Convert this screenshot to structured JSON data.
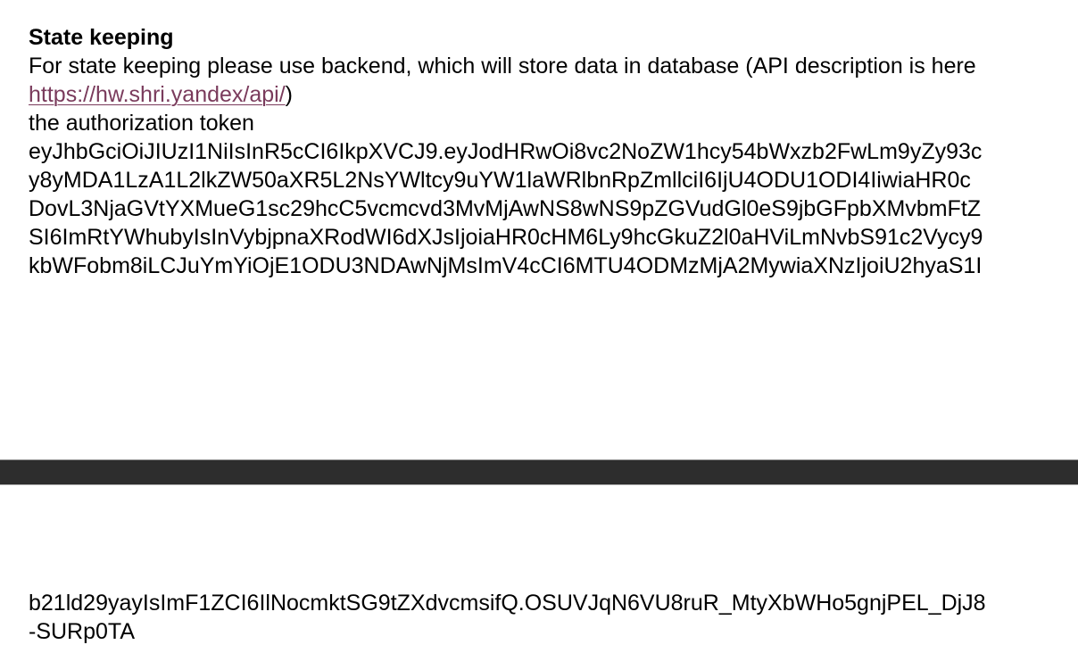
{
  "section": {
    "heading": "State keeping",
    "intro": "For state keeping please use backend, which will store data in database (API description is here",
    "api_link_text": "https://hw.shri.yandex/api/",
    "api_link_suffix": ")",
    "token_label": "the authorization token",
    "token_lines_page1": [
      "eyJhbGciOiJIUzI1NiIsInR5cCI6IkpXVCJ9.eyJodHRwOi8vc2NoZW1hcy54bWxzb2FwLm9yZy93c",
      "y8yMDA1LzA1L2lkZW50aXR5L2NsYWltcy9uYW1laWRlbnRpZmllciI6IjU4ODU1ODI4IiwiaHR0c",
      "DovL3NjaGVtYXMueG1sc29hcC5vcmcvd3MvMjAwNS8wNS9pZGVudGl0eS9jbGFpbXMvbmFtZ",
      "SI6ImRtYWhubyIsInVybjpnaXRodWI6dXJsIjoiaHR0cHM6Ly9hcGkuZ2l0aHViLmNvbS91c2Vycy9",
      "kbWFobm8iLCJuYmYiOjE1ODU3NDAwNjMsImV4cCI6MTU4ODMzMjA2MywiaXNzIjoiU2hyaS1I"
    ],
    "token_lines_page2": [
      "b21ld29yayIsImF1ZCI6IlNocmktSG9tZXdvcmsifQ.OSUVJqN6VU8ruR_MtyXbWHo5gnjPEL_DjJ8",
      "-SURp0TA"
    ]
  }
}
